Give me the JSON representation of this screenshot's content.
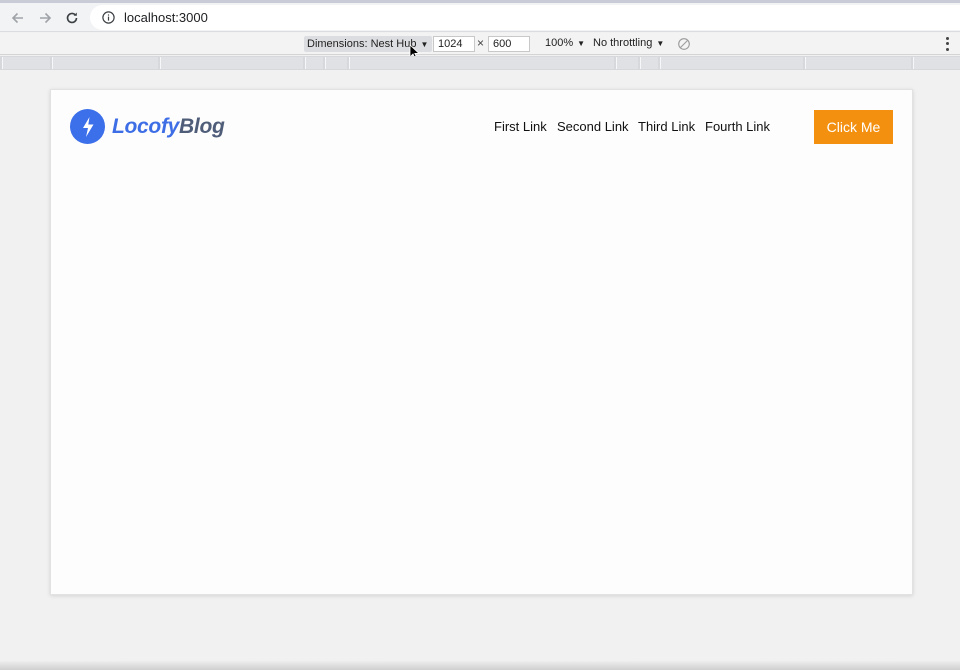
{
  "browser": {
    "url": "localhost:3000",
    "icons": {
      "back": "arrow-left-icon",
      "forward": "arrow-right-icon",
      "reload": "reload-icon",
      "site_info": "info-icon"
    }
  },
  "device_toolbar": {
    "dimensions_label": "Dimensions: Nest Hub",
    "width": "1024",
    "height": "600",
    "times": "×",
    "zoom": "100%",
    "throttling": "No throttling",
    "caret": "▼"
  },
  "site": {
    "logo": {
      "word1": "Locofy",
      "word2": "Blog",
      "icon": "lightning-bolt-icon"
    },
    "nav_links": [
      "First Link",
      "Second Link",
      "Third Link",
      "Fourth Link"
    ],
    "cta_label": "Click Me",
    "colors": {
      "brand_blue": "#3e6ee6",
      "cta_orange": "#f39010"
    }
  }
}
